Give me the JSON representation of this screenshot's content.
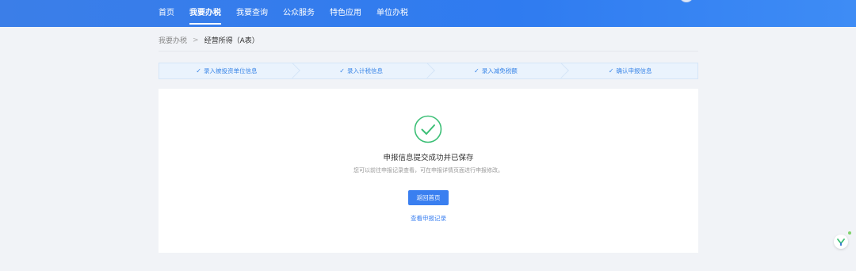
{
  "nav": {
    "items": [
      {
        "label": "首页"
      },
      {
        "label": "我要办税",
        "active": true
      },
      {
        "label": "我要查询"
      },
      {
        "label": "公众服务"
      },
      {
        "label": "特色应用"
      },
      {
        "label": "单位办税"
      }
    ]
  },
  "breadcrumb": {
    "parent": "我要办税",
    "separator": ">",
    "current": "经营所得（A表）"
  },
  "steps": [
    {
      "label": "录入被投资单位信息",
      "done": true
    },
    {
      "label": "录入计税信息",
      "done": true
    },
    {
      "label": "录入减免税额",
      "done": true
    },
    {
      "label": "确认申报信息",
      "done": true
    }
  ],
  "result": {
    "title": "申报信息提交成功并已保存",
    "description": "您可以前往申报记录查看，可在申报详情页面进行申报修改。",
    "primary_button": "返回首页",
    "link": "查看申报记录"
  },
  "colors": {
    "primary": "#3a7ff0",
    "success": "#3cbf76",
    "nav_bg": "#2f7bf0",
    "step_bg": "#eaf3fd"
  },
  "icons": {
    "success": "check-circle-icon",
    "step_done": "check-icon",
    "float_logo": "y-logo-icon"
  }
}
